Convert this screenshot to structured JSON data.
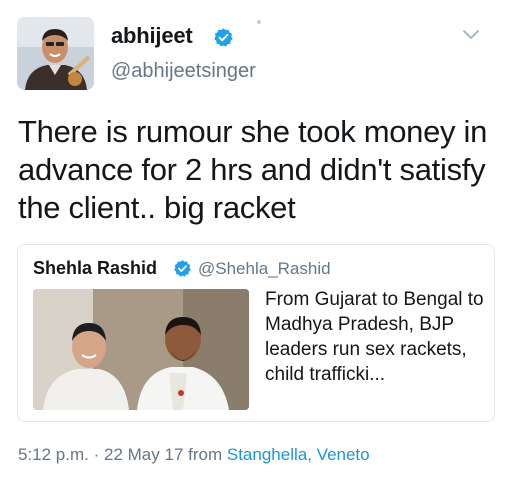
{
  "user": {
    "display_name": "abhijeet",
    "handle": "@abhijeetsinger",
    "verified": true
  },
  "tweet": {
    "text": "There is rumour she took money in advance for 2 hrs and didn't satisfy the client.. big racket"
  },
  "quote": {
    "display_name": "Shehla Rashid",
    "handle": "@Shehla_Rashid",
    "verified": true,
    "text": "From Gujarat to Bengal to Madhya Pradesh, BJP leaders run sex rackets, child trafficki..."
  },
  "meta": {
    "time": "5:12 p.m.",
    "separator": "·",
    "date": "22 May 17",
    "from_label": "from",
    "location": "Stanghella, Veneto"
  },
  "icons": {
    "verified": "verified-badge-icon",
    "menu": "chevron-down-icon"
  },
  "colors": {
    "text": "#14171a",
    "secondary": "#657786",
    "link": "#1b95e0",
    "verified": "#1da1f2",
    "border": "#e1e8ed"
  }
}
